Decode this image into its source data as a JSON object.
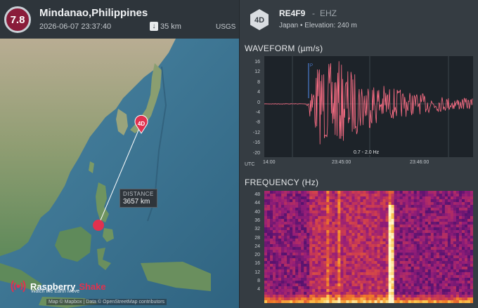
{
  "event": {
    "magnitude": "7.8",
    "title": "Mindanao,Philippines",
    "time": "2026-06-07 23:37:40",
    "depth": "35 km",
    "agency": "USGS"
  },
  "map": {
    "station_marker": "4D",
    "distance_label": "DISTANCE",
    "distance_value": "3657 km",
    "brand_name": "Raspberry",
    "brand_name_2": "Shake",
    "brand_tagline": "Watch the Earth Move",
    "attribution": "Map © Mapbox | Data © OpenStreetMap contributors"
  },
  "station": {
    "badge": "4D",
    "code": "RE4F9",
    "separator": "-",
    "channel": "EHZ",
    "location": "Japan • Elevation: 240 m"
  },
  "waveform": {
    "title": "WAVEFORM (µm/s)",
    "y_ticks": [
      "16",
      "12",
      "8",
      "4",
      "0",
      "-4",
      "-8",
      "-12",
      "-16",
      "-20"
    ],
    "x_ticks": [
      "UTC",
      "14:00",
      "23:45:00",
      "23:46:00"
    ],
    "filter": "0.7 - 2.0 Hz",
    "p_marker": "P"
  },
  "frequency": {
    "title": "FREQUENCY (Hz)",
    "y_ticks": [
      "48",
      "44",
      "40",
      "36",
      "32",
      "28",
      "24",
      "20",
      "16",
      "12",
      "8",
      "4"
    ]
  },
  "colors": {
    "magnitude": "#8a1c3a",
    "event_marker": "#e0314f",
    "waveform": "#ff6f86",
    "brand": "#e0314f"
  }
}
